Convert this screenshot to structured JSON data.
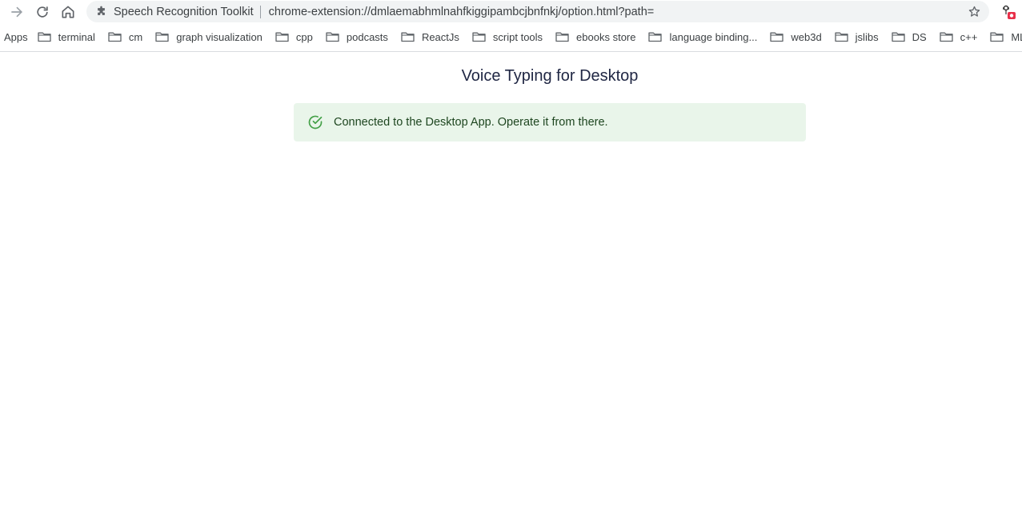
{
  "browser": {
    "tab_site_name": "Speech Recognition Toolkit",
    "url": "chrome-extension://dmlaemabhmlnahfkiggipambcjbnfnkj/option.html?path=",
    "icons": {
      "forward": "arrow-forward-icon",
      "reload": "reload-icon",
      "home": "home-icon",
      "extension": "puzzle-icon",
      "bookmark_star": "star-icon",
      "recording_extension": "mic-record-icon"
    }
  },
  "bookmarks": {
    "apps_label": "Apps",
    "items": [
      {
        "label": "terminal"
      },
      {
        "label": "cm"
      },
      {
        "label": "graph visualization"
      },
      {
        "label": "cpp"
      },
      {
        "label": "podcasts"
      },
      {
        "label": "ReactJs"
      },
      {
        "label": "script tools"
      },
      {
        "label": "ebooks store"
      },
      {
        "label": "language binding..."
      },
      {
        "label": "web3d"
      },
      {
        "label": "jslibs"
      },
      {
        "label": "DS"
      },
      {
        "label": "c++"
      },
      {
        "label": "ML"
      }
    ]
  },
  "page": {
    "title": "Voice Typing for Desktop",
    "alert": {
      "message": "Connected to the Desktop App. Operate it from there.",
      "icon": "check-circle-icon",
      "color": "#43a047",
      "background": "#e9f5ea"
    }
  }
}
